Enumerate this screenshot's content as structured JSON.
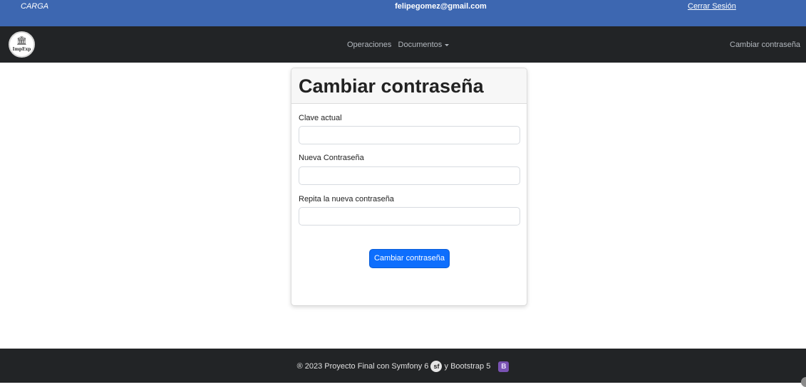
{
  "topbar": {
    "role": "CARGA",
    "email": "felipegomez@gmail.com",
    "logout": "Cerrar Sesión",
    "bg_color": "#3d67b1"
  },
  "navbar": {
    "logo_text": "ImpExp",
    "logo_icon": "bank-icon",
    "items": [
      {
        "label": "Operaciones"
      },
      {
        "label": "Documentos",
        "dropdown": true
      }
    ],
    "right_link": "Cambiar contraseña",
    "bg_color": "#222426"
  },
  "card": {
    "title": "Cambiar contraseña",
    "fields": [
      {
        "label": "Clave actual",
        "value": ""
      },
      {
        "label": "Nueva Contraseña",
        "value": ""
      },
      {
        "label": "Repita la nueva contraseña",
        "value": ""
      }
    ],
    "submit": "Cambiar contraseña",
    "button_color": "#0d6efd"
  },
  "footer": {
    "text_before": "® 2023 Proyecto Final con Symfony 6",
    "symfony_icon": "symfony-icon",
    "text_between": "y Bootstrap 5",
    "bootstrap_icon": "bootstrap-icon"
  }
}
